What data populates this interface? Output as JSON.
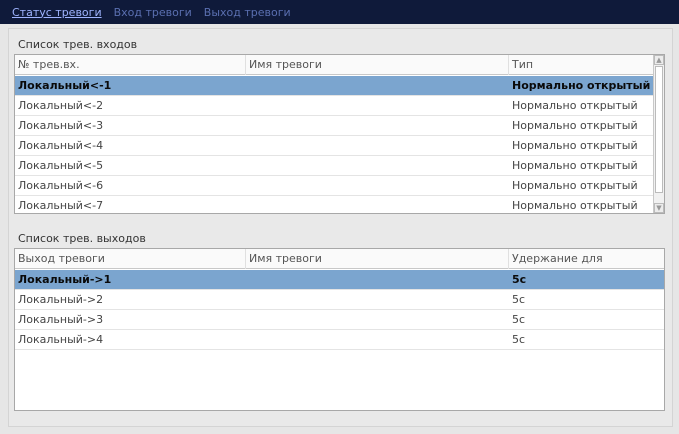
{
  "tabs": [
    {
      "label": "Статус тревоги",
      "active": true
    },
    {
      "label": "Вход тревоги",
      "active": false
    },
    {
      "label": "Выход тревоги",
      "active": false
    }
  ],
  "inputs": {
    "title": "Список трев. входов",
    "columns": [
      "№ трев.вх.",
      "Имя тревоги",
      "Тип"
    ],
    "rows": [
      {
        "id": "Локальный<-1",
        "name": "",
        "type": "Нормально открытый",
        "selected": true
      },
      {
        "id": "Локальный<-2",
        "name": "",
        "type": "Нормально открытый",
        "selected": false
      },
      {
        "id": "Локальный<-3",
        "name": "",
        "type": "Нормально открытый",
        "selected": false
      },
      {
        "id": "Локальный<-4",
        "name": "",
        "type": "Нормально открытый",
        "selected": false
      },
      {
        "id": "Локальный<-5",
        "name": "",
        "type": "Нормально открытый",
        "selected": false
      },
      {
        "id": "Локальный<-6",
        "name": "",
        "type": "Нормально открытый",
        "selected": false
      },
      {
        "id": "Локальный<-7",
        "name": "",
        "type": "Нормально открытый",
        "selected": false
      }
    ]
  },
  "outputs": {
    "title": "Список трев. выходов",
    "columns": [
      "Выход тревоги",
      "Имя тревоги",
      "Удержание для"
    ],
    "rows": [
      {
        "id": "Локальный->1",
        "name": "",
        "hold": "5с",
        "selected": true
      },
      {
        "id": "Локальный->2",
        "name": "",
        "hold": "5с",
        "selected": false
      },
      {
        "id": "Локальный->3",
        "name": "",
        "hold": "5с",
        "selected": false
      },
      {
        "id": "Локальный->4",
        "name": "",
        "hold": "5с",
        "selected": false
      }
    ]
  },
  "colors": {
    "selected_row": "#7ba5cf",
    "top_bar": "#0f1a3a",
    "active_tab": "#9fb4ff"
  },
  "icons": {
    "scroll_up": "chevron-up-icon",
    "scroll_down": "chevron-down-icon"
  }
}
